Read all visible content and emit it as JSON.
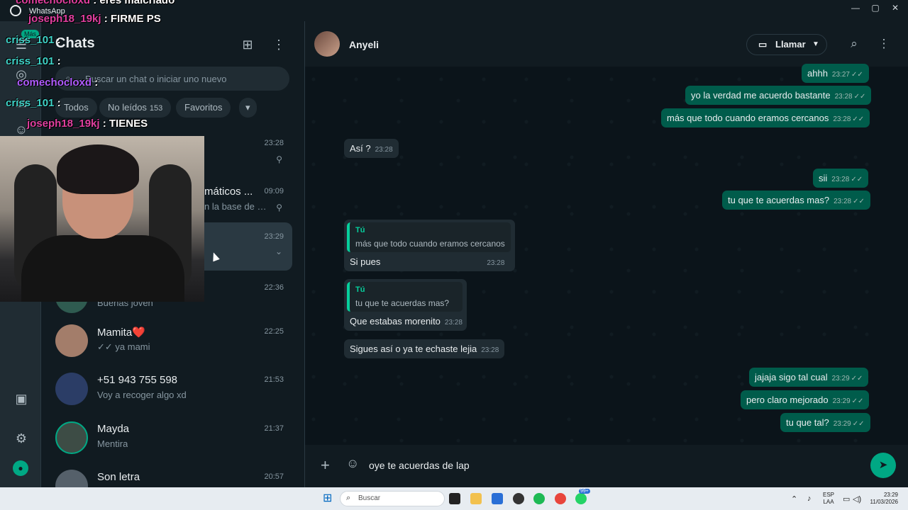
{
  "window": {
    "app_name": "WhatsApp",
    "controls": [
      "—",
      "▢",
      "✕"
    ]
  },
  "rail": {
    "badge": "Más",
    "icons": [
      "chats-icon",
      "status-icon",
      "calls-icon",
      "channels-icon",
      "media-icon",
      "settings-icon",
      "profile-icon"
    ]
  },
  "chat_list": {
    "title": "Chats",
    "search_placeholder": "Buscar un chat o iniciar uno nuevo",
    "filters": [
      {
        "label": "Todos"
      },
      {
        "label": "No leídos",
        "count": "153"
      },
      {
        "label": "Favoritos"
      }
    ],
    "items": [
      {
        "name": "",
        "preview": "",
        "time": "23:28",
        "pinned": true
      },
      {
        "name": "máticos ...",
        "preview": "n la base de d...",
        "time": "09:09",
        "pinned": true
      },
      {
        "name": "",
        "preview": "",
        "time": "23:29",
        "active": true
      },
      {
        "name": "",
        "preview": "Buenas joven",
        "time": "22:36"
      },
      {
        "name": "Mamita❤️",
        "preview": "✓✓ ya mami",
        "time": "22:25"
      },
      {
        "name": "+51 943 755 598",
        "preview": "Voy a recoger algo xd",
        "time": "21:53"
      },
      {
        "name": "Mayda",
        "preview": "Mentira",
        "time": "21:37"
      },
      {
        "name": "Son letra",
        "preview": "",
        "time": "20:57"
      }
    ]
  },
  "conversation": {
    "contact": "Anyeli",
    "call_label": "Llamar",
    "messages": [
      {
        "dir": "out",
        "text": "ahhh",
        "time": "23:27"
      },
      {
        "dir": "out",
        "text": "yo la verdad me acuerdo bastante",
        "time": "23:28"
      },
      {
        "dir": "out",
        "text": "más que todo cuando eramos cercanos",
        "time": "23:28"
      },
      {
        "dir": "in",
        "text": "Así ?",
        "time": "23:28"
      },
      {
        "dir": "out",
        "text": "sii",
        "time": "23:28"
      },
      {
        "dir": "out",
        "text": "tu que te acuerdas mas?",
        "time": "23:28"
      },
      {
        "dir": "in",
        "quote_author": "Tú",
        "quote_text": "más que todo cuando eramos cercanos",
        "text": "Si pues",
        "time": "23:28"
      },
      {
        "dir": "in",
        "quote_author": "Tú",
        "quote_text": "tu que te acuerdas mas?",
        "text": "Que estabas morenito",
        "time": "23:28"
      },
      {
        "dir": "in",
        "text": "Sigues así o ya te echaste lejia",
        "time": "23:28"
      },
      {
        "dir": "out",
        "text": "jajaja sigo tal cual",
        "time": "23:29"
      },
      {
        "dir": "out",
        "text": "pero claro mejorado",
        "time": "23:29"
      },
      {
        "dir": "out",
        "text": "tu que tal?",
        "time": "23:29"
      }
    ],
    "composer_value": "oye te acuerdas de lap"
  },
  "stream_chat": [
    {
      "user": "comechocloxd",
      "msg": ": eres malcriado"
    },
    {
      "user": "joseph18_19kj",
      "msg": ": FIRME PS"
    },
    {
      "user": "criss_101",
      "msg": ":"
    },
    {
      "user": "criss_101",
      "msg": ":"
    },
    {
      "user": "comechocloxd",
      "msg": ":"
    },
    {
      "user": "criss_101",
      "msg": ":"
    },
    {
      "user": "joseph18_19kj",
      "msg": ": TIENES"
    }
  ],
  "taskbar": {
    "search_label": "Buscar",
    "lang": [
      "ESP",
      "LAA"
    ],
    "time": "23:29",
    "date": "11/03/2026",
    "badge": "99+"
  }
}
